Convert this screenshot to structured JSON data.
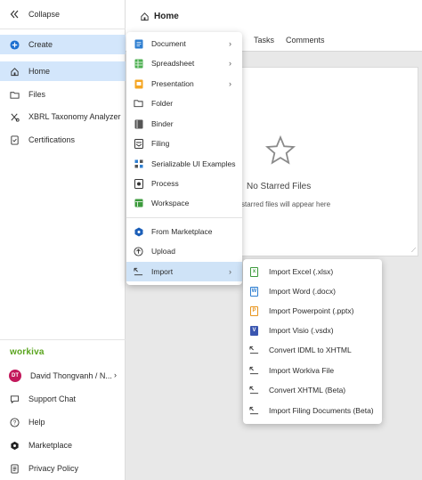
{
  "sidebar": {
    "collapse_label": "Collapse",
    "create_label": "Create",
    "items": [
      {
        "label": "Home"
      },
      {
        "label": "Files"
      },
      {
        "label": "XBRL Taxonomy Analyzer"
      },
      {
        "label": "Certifications"
      }
    ],
    "brand": "workiva",
    "user": {
      "initials": "DT",
      "name": "David Thongvanh / N..."
    },
    "footer": [
      {
        "label": "Support Chat"
      },
      {
        "label": "Help"
      },
      {
        "label": "Marketplace"
      },
      {
        "label": "Privacy Policy"
      }
    ]
  },
  "header": {
    "title": "Home",
    "tabs": [
      {
        "label": "Tasks"
      },
      {
        "label": "Comments"
      }
    ]
  },
  "empty_state": {
    "title": "No Starred Files",
    "subtitle": "starred files will appear here"
  },
  "create_menu": {
    "items": [
      {
        "label": "Document",
        "icon": "document-icon",
        "color": "#2f7fd1"
      },
      {
        "label": "Spreadsheet",
        "icon": "spreadsheet-icon",
        "color": "#4caf50"
      },
      {
        "label": "Presentation",
        "icon": "presentation-icon",
        "color": "#f5a623"
      },
      {
        "label": "Folder",
        "icon": "folder-icon"
      },
      {
        "label": "Binder",
        "icon": "binder-icon"
      },
      {
        "label": "Filing",
        "icon": "filing-icon"
      },
      {
        "label": "Serializable UI Examples",
        "icon": "grid-icon"
      },
      {
        "label": "Process",
        "icon": "process-icon"
      },
      {
        "label": "Workspace",
        "icon": "workspace-icon",
        "color": "#3d9b3d"
      },
      {
        "label": "From Marketplace",
        "icon": "marketplace-icon",
        "color": "#1c5fb8"
      },
      {
        "label": "Upload",
        "icon": "upload-icon"
      },
      {
        "label": "Import",
        "icon": "import-icon"
      }
    ]
  },
  "import_menu": {
    "items": [
      {
        "label": "Import Excel (.xlsx)",
        "icon": "excel-file-icon",
        "color": "#3c9a3c"
      },
      {
        "label": "Import Word (.docx)",
        "icon": "word-file-icon",
        "color": "#2f7fd1"
      },
      {
        "label": "Import Powerpoint (.pptx)",
        "icon": "powerpoint-file-icon",
        "color": "#e8951e"
      },
      {
        "label": "Import Visio (.vsdx)",
        "icon": "visio-file-icon",
        "color": "#3a56b0"
      },
      {
        "label": "Convert IDML to XHTML",
        "icon": "import-icon"
      },
      {
        "label": "Import Workiva File",
        "icon": "import-icon"
      },
      {
        "label": "Convert XHTML (Beta)",
        "icon": "import-icon"
      },
      {
        "label": "Import Filing Documents (Beta)",
        "icon": "import-icon"
      }
    ]
  },
  "colors": {
    "active_bg": "#d3e6fb",
    "brand": "#5aa41e",
    "avatar": "#c2185b"
  }
}
